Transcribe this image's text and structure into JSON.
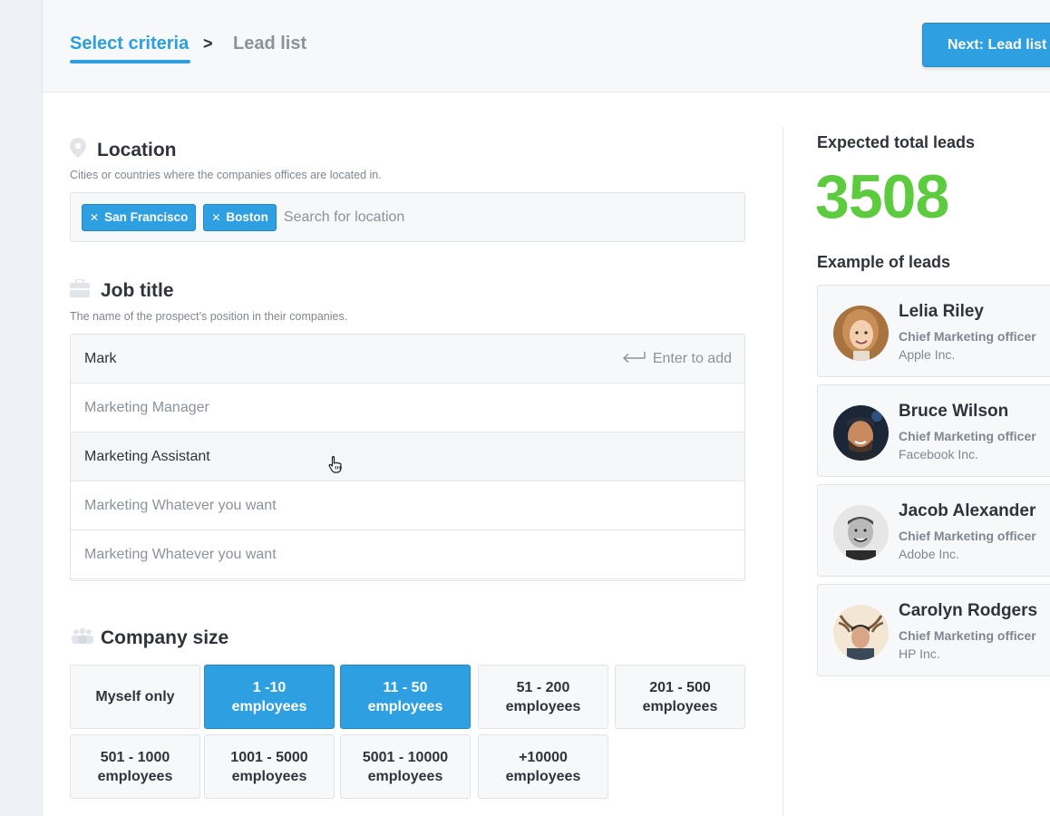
{
  "header": {
    "step_active": "Select criteria",
    "step_separator": ">",
    "step_inactive": "Lead list",
    "next_button": "Next: Lead list"
  },
  "location": {
    "icon": "map-pin-icon",
    "title": "Location",
    "description": "Cities or countries where the companies offices are located in.",
    "tags": [
      "San Francisco",
      "Boston"
    ],
    "placeholder": "Search for location"
  },
  "job_title": {
    "icon": "briefcase-icon",
    "title": "Job title",
    "description": "The name of the prospect’s position in their companies.",
    "input_value": "Mark",
    "enter_hint": "Enter to add",
    "suggestions": [
      "Marketing Manager",
      "Marketing Assistant",
      "Marketing Whatever you want",
      "Marketing Whatever you want"
    ]
  },
  "company_size": {
    "icon": "people-icon",
    "title": "Company size",
    "options": [
      {
        "line1": "Myself only",
        "line2": "",
        "selected": false
      },
      {
        "line1": "1 -10",
        "line2": "employees",
        "selected": true
      },
      {
        "line1": "11 - 50",
        "line2": "employees",
        "selected": true
      },
      {
        "line1": "51 - 200",
        "line2": "employees",
        "selected": false
      },
      {
        "line1": "201 - 500",
        "line2": "employees",
        "selected": false
      },
      {
        "line1": "501 - 1000",
        "line2": "employees",
        "selected": false
      },
      {
        "line1": "1001 - 5000",
        "line2": "employees",
        "selected": false
      },
      {
        "line1": "5001 - 10000",
        "line2": "employees",
        "selected": false
      },
      {
        "line1": "+10000",
        "line2": "employees",
        "selected": false
      }
    ]
  },
  "summary": {
    "expected_label": "Expected total leads",
    "expected_value": "3508",
    "examples_label": "Example of leads",
    "leads": [
      {
        "name": "Lelia Riley",
        "role": "Chief Marketing officer",
        "company": "Apple Inc."
      },
      {
        "name": "Bruce Wilson",
        "role": "Chief Marketing officer",
        "company": "Facebook Inc."
      },
      {
        "name": "Jacob Alexander",
        "role": "Chief Marketing officer",
        "company": "Adobe Inc."
      },
      {
        "name": "Carolyn Rodgers",
        "role": "Chief Marketing officer",
        "company": "HP Inc."
      }
    ]
  },
  "colors": {
    "accent": "#2e9fe0",
    "lead_count": "#5ccb3d"
  }
}
